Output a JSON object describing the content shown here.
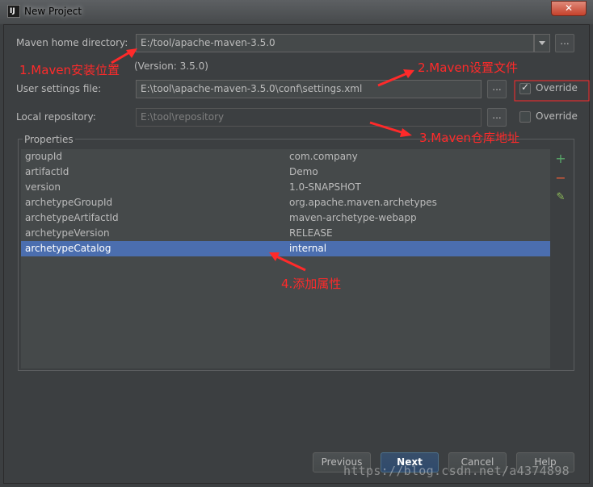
{
  "window": {
    "title": "New Project",
    "app_icon_text": "IJ",
    "close_label": "✕"
  },
  "form": {
    "maven_home_label": "Maven home directory:",
    "maven_home_value": "E:/tool/apache-maven-3.5.0",
    "version_text": "(Version: 3.5.0)",
    "settings_label": "User settings file:",
    "settings_value": "E:\\tool\\apache-maven-3.5.0\\conf\\settings.xml",
    "settings_override_label": "Override",
    "settings_override_checked": true,
    "repo_label": "Local repository:",
    "repo_value": "E:\\tool\\repository",
    "repo_override_label": "Override",
    "repo_override_checked": false,
    "browse_label": "..."
  },
  "properties": {
    "title": "Properties",
    "rows": [
      {
        "key": "groupId",
        "value": "com.company"
      },
      {
        "key": "artifactId",
        "value": "Demo"
      },
      {
        "key": "version",
        "value": "1.0-SNAPSHOT"
      },
      {
        "key": "archetypeGroupId",
        "value": "org.apache.maven.archetypes"
      },
      {
        "key": "archetypeArtifactId",
        "value": "maven-archetype-webapp"
      },
      {
        "key": "archetypeVersion",
        "value": "RELEASE"
      },
      {
        "key": "archetypeCatalog",
        "value": "internal"
      }
    ],
    "selected_index": 6,
    "add_icon": "+",
    "remove_icon": "−",
    "edit_icon": "✎"
  },
  "annotations": {
    "a1": "1.Maven安装位置",
    "a2": "2.Maven设置文件",
    "a3": "3.Maven仓库地址",
    "a4": "4.添加属性",
    "color": "#ff2a2a"
  },
  "buttons": {
    "previous": "Previous",
    "next": "Next",
    "cancel": "Cancel",
    "help": "Help"
  },
  "watermark": "https://blog.csdn.net/a4374898"
}
